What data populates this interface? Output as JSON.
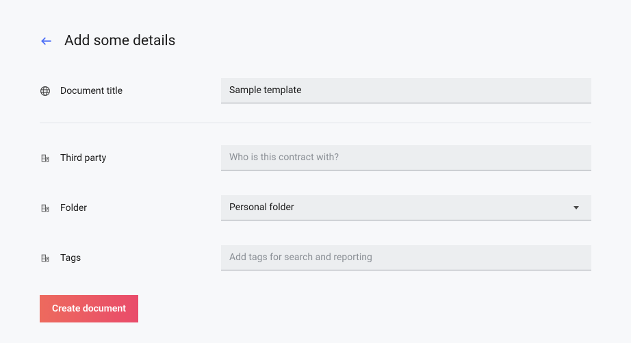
{
  "header": {
    "title": "Add some details"
  },
  "fields": {
    "document_title": {
      "label": "Document title",
      "value": "Sample template",
      "placeholder": ""
    },
    "third_party": {
      "label": "Third party",
      "value": "",
      "placeholder": "Who is this contract with?"
    },
    "folder": {
      "label": "Folder",
      "selected": "Personal folder"
    },
    "tags": {
      "label": "Tags",
      "value": "",
      "placeholder": "Add tags for search and reporting"
    }
  },
  "actions": {
    "create_label": "Create document"
  }
}
